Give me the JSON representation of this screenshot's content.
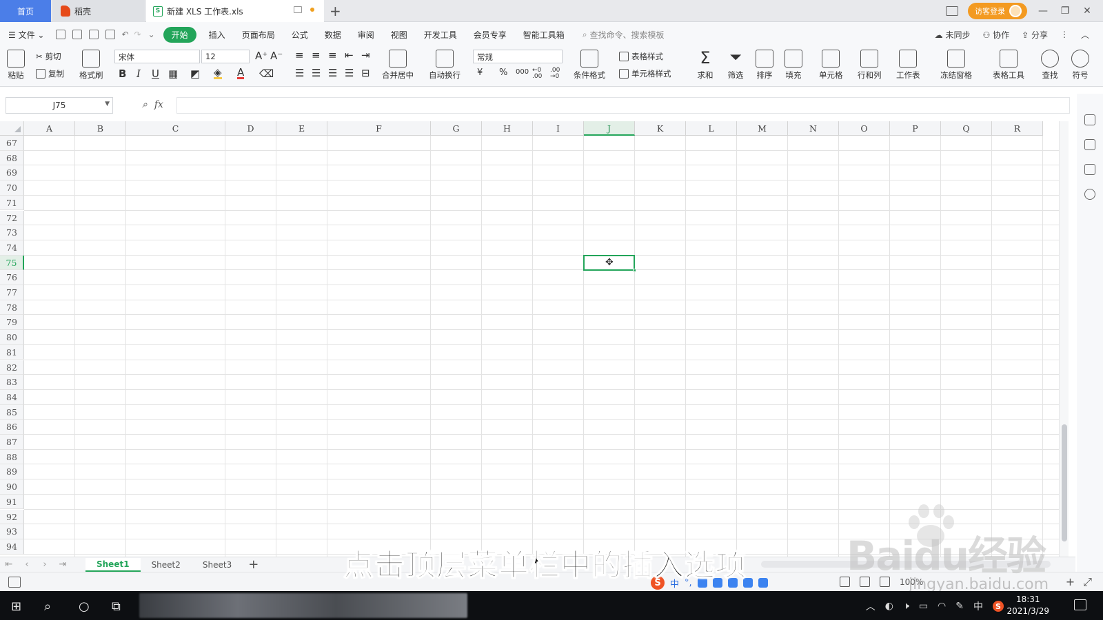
{
  "tabs": {
    "home": "首页",
    "daoke": "稻壳",
    "doc": "新建 XLS 工作表.xls",
    "add": "+"
  },
  "header_right": {
    "login": "访客登录"
  },
  "menubar": {
    "file": "文件",
    "items": [
      "开始",
      "插入",
      "页面布局",
      "公式",
      "数据",
      "审阅",
      "视图",
      "开发工具",
      "会员专享",
      "智能工具箱"
    ],
    "active_index": 0,
    "search_placeholder": "查找命令、搜索模板",
    "sync": "未同步",
    "collab": "协作",
    "share": "分享"
  },
  "ribbon": {
    "paste": "粘贴",
    "cut": "剪切",
    "copy": "复制",
    "format_painter": "格式刷",
    "font_name": "宋体",
    "font_size": "12",
    "merge_center": "合并居中",
    "wrap": "自动换行",
    "number_format": "常规",
    "cond_format": "条件格式",
    "table_style": "表格样式",
    "cell_style": "单元格样式",
    "sum": "求和",
    "filter": "筛选",
    "sort": "排序",
    "fill": "填充",
    "cell": "单元格",
    "row_col": "行和列",
    "worksheet": "工作表",
    "freeze": "冻结窗格",
    "table_tools": "表格工具",
    "find": "查找",
    "symbol": "符号",
    "currency": "¥",
    "percent": "%",
    "thousands": "000",
    "inc_dec": "←0 .00",
    "dec_dec": ".00 →0"
  },
  "formula": {
    "cell_ref": "J75",
    "fx": "fx",
    "value": ""
  },
  "columns": [
    "A",
    "B",
    "C",
    "D",
    "E",
    "F",
    "G",
    "H",
    "I",
    "J",
    "K",
    "L",
    "M",
    "N",
    "O",
    "P",
    "Q",
    "R"
  ],
  "rows": [
    "67",
    "68",
    "69",
    "70",
    "71",
    "72",
    "73",
    "74",
    "75",
    "76",
    "77",
    "78",
    "79",
    "80",
    "81",
    "82",
    "83",
    "84",
    "85",
    "86",
    "87",
    "88",
    "89",
    "90",
    "91",
    "92",
    "93",
    "94"
  ],
  "selected": {
    "column": "J",
    "row": "75"
  },
  "sheets": {
    "tabs": [
      "Sheet1",
      "Sheet2",
      "Sheet3"
    ],
    "active": "Sheet1",
    "add": "+"
  },
  "statusbar": {
    "zoom": "100%"
  },
  "caption": "点击顶层菜单栏中的插入选项",
  "watermark": {
    "brand": "Baidu经验",
    "url": "jingyan.baidu.com"
  },
  "taskbar": {
    "time": "18:31",
    "date": "2021/3/29",
    "tray_lang": "中"
  },
  "colors": {
    "accent": "#23a55a",
    "home_tab": "#4b7ee8",
    "login": "#f39a21"
  }
}
